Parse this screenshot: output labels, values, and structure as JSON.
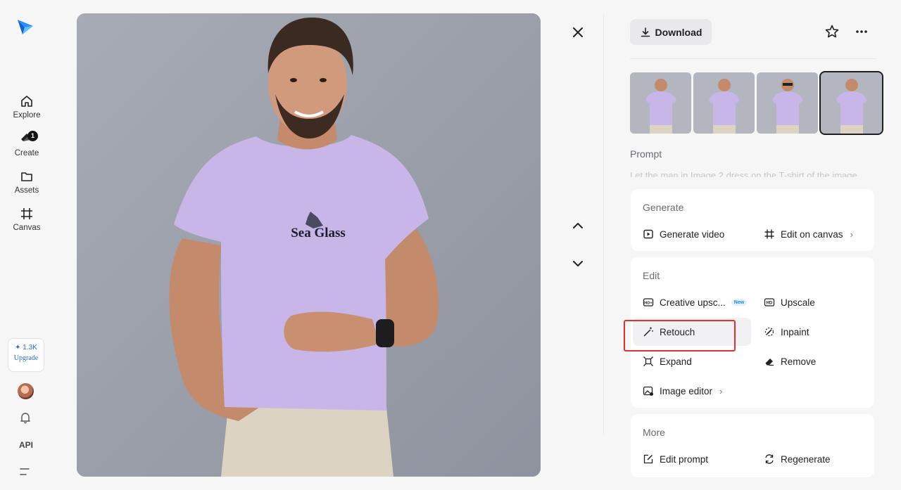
{
  "sidebar": {
    "items": [
      {
        "label": "Explore"
      },
      {
        "label": "Create",
        "badge": "1"
      },
      {
        "label": "Assets"
      },
      {
        "label": "Canvas"
      }
    ],
    "credits": "✦ 1.3K",
    "upgrade": "Upgrade",
    "api": "API"
  },
  "viewer": {
    "shirt_text": "Sea Glass"
  },
  "panel": {
    "download": "Download",
    "prompt_title": "Prompt",
    "prompt_text": "Let the man in Image 2 dress on the T-shirt of the image",
    "generate": {
      "title": "Generate",
      "actions": [
        {
          "label": "Generate video"
        },
        {
          "label": "Edit on canvas",
          "chevron": "›"
        }
      ]
    },
    "edit": {
      "title": "Edit",
      "actions": [
        {
          "label": "Creative upsc...",
          "tag": "New"
        },
        {
          "label": "Upscale"
        },
        {
          "label": "Retouch"
        },
        {
          "label": "Inpaint"
        },
        {
          "label": "Expand"
        },
        {
          "label": "Remove"
        },
        {
          "label": "Image editor",
          "chevron": "›"
        }
      ]
    },
    "more": {
      "title": "More",
      "actions": [
        {
          "label": "Edit prompt"
        },
        {
          "label": "Regenerate"
        }
      ]
    }
  },
  "colors": {
    "accent": "#2a6ad8",
    "highlight_box": "#e2312f",
    "shirt": "#c9b6e8"
  },
  "icons": [
    "logo-icon",
    "home-icon",
    "create-icon",
    "folder-icon",
    "canvas-icon",
    "bell-icon",
    "menu-icon",
    "close-icon",
    "chevron-up-icon",
    "chevron-down-icon",
    "download-icon",
    "star-icon",
    "more-icon",
    "play-icon",
    "crop-icon",
    "hd-icon",
    "wand-icon",
    "inpaint-icon",
    "expand-icon",
    "eraser-icon",
    "image-editor-icon",
    "edit-prompt-icon",
    "regenerate-icon"
  ]
}
